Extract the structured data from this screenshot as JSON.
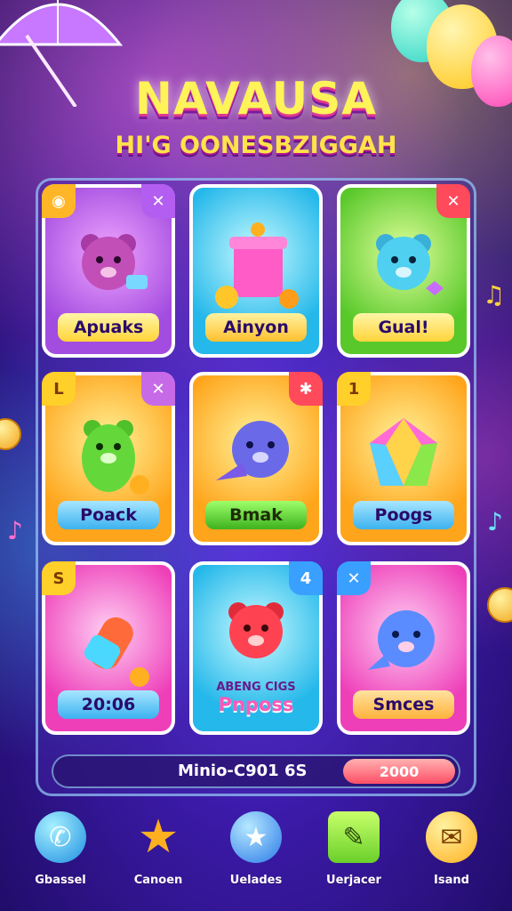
{
  "header": {
    "title": "NAVAUSA",
    "subtitle": "HI'G OONESBZIGGAH"
  },
  "cards": [
    {
      "label": "Apuaks",
      "corner_left": "",
      "corner_right": "✕",
      "theme": "purple",
      "art": "bear"
    },
    {
      "label": "Ainyon",
      "corner_left": "",
      "corner_right": "",
      "theme": "cyan",
      "art": "jar"
    },
    {
      "label": "Gual!",
      "corner_left": "",
      "corner_right": "✕",
      "theme": "green",
      "art": "bear"
    },
    {
      "label": "Poack",
      "corner_left": "",
      "corner_right": "✕",
      "theme": "orange",
      "art": "bear"
    },
    {
      "label": "Bmak",
      "corner_left": "",
      "corner_right": "✱",
      "theme": "orange",
      "art": "creature"
    },
    {
      "label": "Poogs",
      "corner_left": "1",
      "corner_right": "",
      "theme": "orange",
      "art": "gem"
    },
    {
      "label": "20:06",
      "corner_left": "S",
      "corner_right": "",
      "theme": "pink",
      "art": "rocket"
    },
    {
      "label": "Pnposs",
      "sublabel": "ABENG CIGS",
      "corner_left": "",
      "corner_right": "4",
      "theme": "cyan",
      "art": "bear"
    },
    {
      "label": "Smces",
      "corner_left": "✕",
      "corner_right": "",
      "theme": "pink",
      "art": "creature"
    }
  ],
  "status_bar": {
    "text": "Minio-C901 6S",
    "value": "2000"
  },
  "nav": [
    {
      "label": "Gbassel",
      "icon": "phone-icon"
    },
    {
      "label": "Canoen",
      "icon": "star-icon"
    },
    {
      "label": "Uelades",
      "icon": "star-badge-icon"
    },
    {
      "label": "Uerjacer",
      "icon": "notepad-icon"
    },
    {
      "label": "Isand",
      "icon": "chat-icon"
    }
  ]
}
